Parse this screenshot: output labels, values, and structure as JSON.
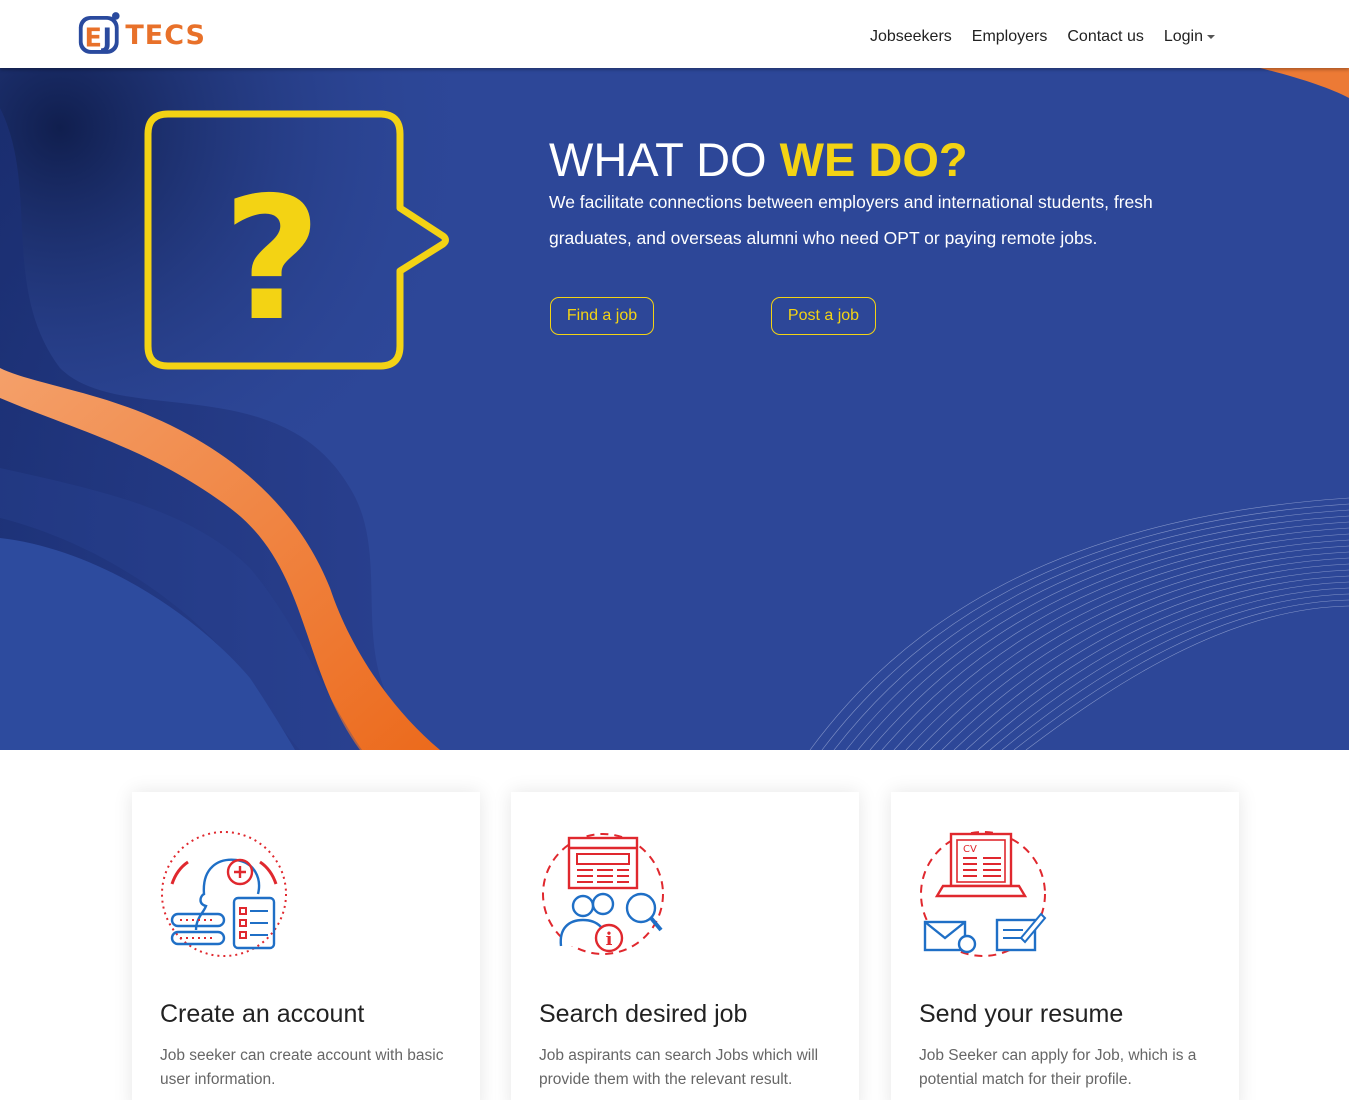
{
  "header": {
    "logo_text": "TECS",
    "logo_mark": "EJ",
    "nav": [
      {
        "label": "Jobseekers"
      },
      {
        "label": "Employers"
      },
      {
        "label": "Contact us"
      },
      {
        "label": "Login"
      }
    ]
  },
  "hero": {
    "title_plain": "WHAT DO ",
    "title_accent": "WE DO?",
    "description": "We facilitate connections between employers and international students, fresh graduates, and overseas alumni who need OPT or paying remote jobs.",
    "find_button": "Find a job",
    "post_button": "Post a job",
    "illustration_icon": "question-mark-speech-bubble"
  },
  "cards": [
    {
      "title": "Create an account",
      "text": "Job seeker can create account with basic user information.",
      "icon": "user-account-icon"
    },
    {
      "title": "Search desired job",
      "text": "Job aspirants can search Jobs which will provide them with the relevant result.",
      "icon": "job-search-icon"
    },
    {
      "title": "Send your resume",
      "text": "Job Seeker can apply for Job, which is a potential match for their profile.",
      "icon": "resume-send-icon"
    }
  ],
  "colors": {
    "brand_orange": "#e8712a",
    "brand_blue": "#2a4a9e",
    "hero_blue": "#2c4596",
    "accent_yellow": "#f3d314",
    "icon_red": "#e0282e",
    "icon_blue": "#1f6fc6"
  }
}
